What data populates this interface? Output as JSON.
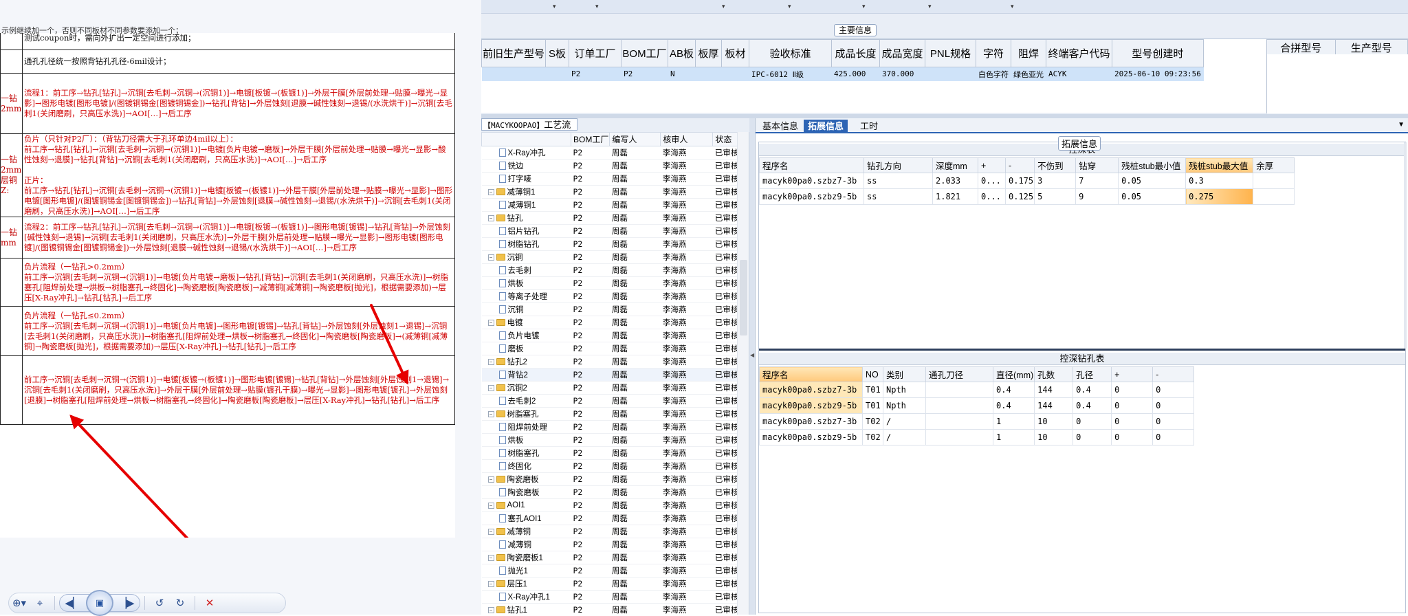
{
  "doc": {
    "top_fragment": "示例继续加一个，否则不同板材不同参数要添加一个；",
    "rows": [
      {
        "label": "",
        "text": "测试coupon时，需向外扩出一定空间进行添加；",
        "style": "blk"
      },
      {
        "label": "",
        "text": "通孔孔径统一按照背钻孔孔径-6mil设计；",
        "style": "blk"
      },
      {
        "label": "一钻\n2mm",
        "text": "流程1：前工序→钻孔[钻孔]→沉铜[去毛刺→沉铜→(沉铜1)]→电镀[板镀→(板镀1)]→外层干膜[外层前处理→贴膜→曝光→显影]→图形电镀[图形电镀]/(图镀铜锡金[图镀铜锡金])→钻孔[背钻]→外层蚀刻[退膜→碱性蚀刻→退锡/(水洗烘干)]→沉铜[去毛刺1(关闭磨刷，只高压水洗)]→AOI[…]→后工序",
        "style": "red"
      },
      {
        "label": "一钻\n2mm\n层铜\nZ:",
        "text": "负片（只针对P2厂）：（背钻刀径需大于孔环单边4mil以上）：\n前工序→钻孔[钻孔]→沉铜[去毛刺→沉铜→(沉铜1)]→电镀[负片电镀→磨板]→外层干膜[外层前处理→贴膜→曝光→显影→酸性蚀刻→退膜]→钻孔[背钻]→沉铜[去毛刺1(关闭磨刷，只高压水洗)]→AOI[…]→后工序\n\n正片：\n前工序→钻孔[钻孔]→沉铜[去毛刺→沉铜→(沉铜1)]→电镀[板镀→(板镀1)]→外层干膜[外层前处理→贴膜→曝光→显影]→图形电镀[图形电镀]/(图镀铜锡金[图镀铜锡金])→钻孔[背钻]→外层蚀刻[退膜→碱性蚀刻→退锡/(水洗烘干)]→沉铜[去毛刺1(关闭磨刷，只高压水洗)]→AOI[…]→后工序",
        "style": "red"
      },
      {
        "label": "一钻\nmm",
        "text": "流程2：前工序→钻孔[钻孔]→沉铜[去毛刺→沉铜→(沉铜1)]→电镀[板镀→(板镀1)]→图形电镀[镀锡]→钻孔[背钻]→外层蚀刻[碱性蚀刻→退锡]→沉铜[去毛刺1(关闭磨刷，只高压水洗)]→外层干膜[外层前处理→贴膜→曝光→显影]→图形电镀[图形电镀]/(图镀铜锡金[图镀铜锡金])→外层蚀刻[退膜→碱性蚀刻→退锡/(水洗烘干)]→AOI[…]→后工序",
        "style": "red"
      },
      {
        "label": "",
        "text": "负片流程（一钻孔>0.2mm）\n前工序→沉铜[去毛刺→沉铜→(沉铜1)]→电镀[负片电镀→磨板]→钻孔[背钻]→沉铜[去毛刺1(关闭磨刷，只高压水洗)]→树脂塞孔[阻焊前处理→烘板→树脂塞孔→终固化]→陶瓷磨板[陶瓷磨板]→减薄铜[减薄铜]→陶瓷磨板[抛光]，根据需要添加)→层压[X-Ray冲孔]→钻孔[钻孔]→后工序",
        "style": "red"
      },
      {
        "label": "",
        "text": "负片流程（一钻孔≤0.2mm）\n前工序→沉铜[去毛刺→沉铜→(沉铜1)]→电镀[负片电镀]→图形电镀[镀锡]→钻孔[背钻]→外层蚀刻[外层蚀刻1→退锡]→沉铜[去毛刺1(关闭磨刷，只高压水洗)]→树脂塞孔[阻焊前处理→烘板→树脂塞孔→终固化]→陶瓷磨板[陶瓷磨板]→(减薄铜[减薄铜]→陶瓷磨板[抛光]，根据需要添加)→层压[X-Ray冲孔]→钻孔[钻孔]→后工序",
        "style": "red"
      },
      {
        "label": "",
        "text": "前工序→沉铜[去毛刺→沉铜→(沉铜1)]→电镀[板镀→(板镀1)]→图形电镀[镀锡]→钻孔[背钻]→外层蚀刻[外层蚀刻1→退锡]→沉铜[去毛刺1(关闭磨刷，只高压水洗)]→外层干膜[外层前处理→贴膜(镀孔干膜)→曝光→显影]→图形电镀[镀孔]→外层蚀刻[退膜]→树脂塞孔[阻焊前处理→烘板→树脂塞孔→终固化]→陶瓷磨板[陶瓷磨板]→层压[X-Ray冲孔]→钻孔[钻孔]→后工序",
        "style": "red"
      }
    ],
    "toolbar_icons": [
      "zoom-icon",
      "fit-page-icon",
      "first-page-icon",
      "prev-page-icon",
      "slideshow-icon",
      "next-page-icon",
      "last-page-icon",
      "rotate-left-icon",
      "rotate-right-icon",
      "delete-icon"
    ]
  },
  "app": {
    "main_info_title": "主要信息",
    "main_columns": [
      "前旧生产型号",
      "S板",
      "订单工厂",
      "BOM工厂",
      "AB板",
      "板厚",
      "板材",
      "验收标准",
      "成品长度",
      "成品宽度",
      "PNL规格",
      "字符",
      "阻焊",
      "终端客户代码",
      "型号创建时"
    ],
    "main_row": [
      "",
      "",
      "P2",
      "P2",
      "N",
      "",
      "",
      "IPC-6012 Ⅱ级",
      "425.000",
      "370.000",
      "",
      "白色字符",
      "绿色亚光",
      "ACYK",
      "2025-06-10 09:23:56"
    ],
    "merge_columns": [
      "合拼型号",
      "生产型号"
    ],
    "process_title_prefix": "【MACYKOOPAO】",
    "process_title": "工艺流程",
    "process_columns": [
      "",
      "BOM工厂",
      "编写人",
      "核审人",
      "状态"
    ],
    "process_rows": [
      {
        "name": "X-Ray冲孔",
        "level": 2,
        "kind": "file",
        "bom": "P2",
        "writer": "周磊",
        "reviewer": "李海燕",
        "status": "已审核"
      },
      {
        "name": "铣边",
        "level": 2,
        "kind": "file",
        "bom": "P2",
        "writer": "周磊",
        "reviewer": "李海燕",
        "status": "已审核"
      },
      {
        "name": "打字唛",
        "level": 2,
        "kind": "file",
        "bom": "P2",
        "writer": "周磊",
        "reviewer": "李海燕",
        "status": "已审核"
      },
      {
        "name": "减薄铜1",
        "level": 1,
        "kind": "folder",
        "bom": "P2",
        "writer": "周磊",
        "reviewer": "李海燕",
        "status": "已审核"
      },
      {
        "name": "减薄铜1",
        "level": 2,
        "kind": "file",
        "bom": "P2",
        "writer": "周磊",
        "reviewer": "李海燕",
        "status": "已审核"
      },
      {
        "name": "钻孔",
        "level": 1,
        "kind": "folder",
        "bom": "P2",
        "writer": "周磊",
        "reviewer": "李海燕",
        "status": "已审核"
      },
      {
        "name": "铝片钻孔",
        "level": 2,
        "kind": "file",
        "bom": "P2",
        "writer": "周磊",
        "reviewer": "李海燕",
        "status": "已审核"
      },
      {
        "name": "树脂钻孔",
        "level": 2,
        "kind": "file",
        "bom": "P2",
        "writer": "周磊",
        "reviewer": "李海燕",
        "status": "已审核"
      },
      {
        "name": "沉铜",
        "level": 1,
        "kind": "folder",
        "bom": "P2",
        "writer": "周磊",
        "reviewer": "李海燕",
        "status": "已审核"
      },
      {
        "name": "去毛刺",
        "level": 2,
        "kind": "file",
        "bom": "P2",
        "writer": "周磊",
        "reviewer": "李海燕",
        "status": "已审核"
      },
      {
        "name": "烘板",
        "level": 2,
        "kind": "file",
        "bom": "P2",
        "writer": "周磊",
        "reviewer": "李海燕",
        "status": "已审核"
      },
      {
        "name": "等离子处理",
        "level": 2,
        "kind": "file",
        "bom": "P2",
        "writer": "周磊",
        "reviewer": "李海燕",
        "status": "已审核"
      },
      {
        "name": "沉铜",
        "level": 2,
        "kind": "file",
        "bom": "P2",
        "writer": "周磊",
        "reviewer": "李海燕",
        "status": "已审核"
      },
      {
        "name": "电镀",
        "level": 1,
        "kind": "folder",
        "bom": "P2",
        "writer": "周磊",
        "reviewer": "李海燕",
        "status": "已审核"
      },
      {
        "name": "负片电镀",
        "level": 2,
        "kind": "file",
        "bom": "P2",
        "writer": "周磊",
        "reviewer": "李海燕",
        "status": "已审核"
      },
      {
        "name": "磨板",
        "level": 2,
        "kind": "file",
        "bom": "P2",
        "writer": "周磊",
        "reviewer": "李海燕",
        "status": "已审核"
      },
      {
        "name": "钻孔2",
        "level": 1,
        "kind": "folder",
        "bom": "P2",
        "writer": "周磊",
        "reviewer": "李海燕",
        "status": "已审核"
      },
      {
        "name": "背钻2",
        "level": 2,
        "kind": "file",
        "bom": "P2",
        "writer": "周磊",
        "reviewer": "李海燕",
        "status": "已审核",
        "selected": true
      },
      {
        "name": "沉铜2",
        "level": 1,
        "kind": "folder",
        "bom": "P2",
        "writer": "周磊",
        "reviewer": "李海燕",
        "status": "已审核"
      },
      {
        "name": "去毛刺2",
        "level": 2,
        "kind": "file",
        "bom": "P2",
        "writer": "周磊",
        "reviewer": "李海燕",
        "status": "已审核"
      },
      {
        "name": "树脂塞孔",
        "level": 1,
        "kind": "folder",
        "bom": "P2",
        "writer": "周磊",
        "reviewer": "李海燕",
        "status": "已审核"
      },
      {
        "name": "阻焊前处理",
        "level": 2,
        "kind": "file",
        "bom": "P2",
        "writer": "周磊",
        "reviewer": "李海燕",
        "status": "已审核"
      },
      {
        "name": "烘板",
        "level": 2,
        "kind": "file",
        "bom": "P2",
        "writer": "周磊",
        "reviewer": "李海燕",
        "status": "已审核"
      },
      {
        "name": "树脂塞孔",
        "level": 2,
        "kind": "file",
        "bom": "P2",
        "writer": "周磊",
        "reviewer": "李海燕",
        "status": "已审核"
      },
      {
        "name": "终固化",
        "level": 2,
        "kind": "file",
        "bom": "P2",
        "writer": "周磊",
        "reviewer": "李海燕",
        "status": "已审核"
      },
      {
        "name": "陶瓷磨板",
        "level": 1,
        "kind": "folder",
        "bom": "P2",
        "writer": "周磊",
        "reviewer": "李海燕",
        "status": "已审核"
      },
      {
        "name": "陶瓷磨板",
        "level": 2,
        "kind": "file",
        "bom": "P2",
        "writer": "周磊",
        "reviewer": "李海燕",
        "status": "已审核"
      },
      {
        "name": "AOI1",
        "level": 1,
        "kind": "folder",
        "bom": "P2",
        "writer": "周磊",
        "reviewer": "李海燕",
        "status": "已审核"
      },
      {
        "name": "塞孔AOI1",
        "level": 2,
        "kind": "file",
        "bom": "P2",
        "writer": "周磊",
        "reviewer": "李海燕",
        "status": "已审核"
      },
      {
        "name": "减薄铜",
        "level": 1,
        "kind": "folder",
        "bom": "P2",
        "writer": "周磊",
        "reviewer": "李海燕",
        "status": "已审核"
      },
      {
        "name": "减薄铜",
        "level": 2,
        "kind": "file",
        "bom": "P2",
        "writer": "周磊",
        "reviewer": "李海燕",
        "status": "已审核"
      },
      {
        "name": "陶瓷磨板1",
        "level": 1,
        "kind": "folder",
        "bom": "P2",
        "writer": "周磊",
        "reviewer": "李海燕",
        "status": "已审核"
      },
      {
        "name": "抛光1",
        "level": 2,
        "kind": "file",
        "bom": "P2",
        "writer": "周磊",
        "reviewer": "李海燕",
        "status": "已审核"
      },
      {
        "name": "层压1",
        "level": 1,
        "kind": "folder",
        "bom": "P2",
        "writer": "周磊",
        "reviewer": "李海燕",
        "status": "已审核"
      },
      {
        "name": "X-Ray冲孔1",
        "level": 2,
        "kind": "file",
        "bom": "P2",
        "writer": "周磊",
        "reviewer": "李海燕",
        "status": "已审核"
      },
      {
        "name": "钻孔1",
        "level": 1,
        "kind": "folder",
        "bom": "P2",
        "writer": "周磊",
        "reviewer": "李海燕",
        "status": "已审核"
      }
    ],
    "tabs": [
      "基本信息",
      "拓展信息",
      "工时"
    ],
    "active_tab": 1,
    "ext_title": "拓展信息",
    "depth_title": "控深表",
    "depth_columns": [
      "程序名",
      "钻孔方向",
      "深度mm",
      "+",
      "-",
      "不伤到",
      "钻穿",
      "残桩stub最小值",
      "残桩stub最大值",
      "余厚"
    ],
    "depth_rows": [
      [
        "macyk00pa0.szbz7-3b",
        "ss",
        "2.033",
        "0...",
        "0.175",
        "3",
        "7",
        "0.05",
        "0.3",
        ""
      ],
      [
        "macyk00pa0.szbz9-5b",
        "ss",
        "1.821",
        "0...",
        "0.125",
        "5",
        "9",
        "0.05",
        "0.275",
        ""
      ]
    ],
    "hole_title": "控深钻孔表",
    "hole_columns": [
      "程序名",
      "NO",
      "类别",
      "通孔刀径",
      "直径(mm)",
      "孔数",
      "孔径",
      "+",
      "-"
    ],
    "hole_rows": [
      [
        "macyk00pa0.szbz7-3b",
        "T01",
        "Npth",
        "",
        "0.4",
        "144",
        "0.4",
        "0",
        "0"
      ],
      [
        "macyk00pa0.szbz9-5b",
        "T01",
        "Npth",
        "",
        "0.4",
        "144",
        "0.4",
        "0",
        "0"
      ],
      [
        "macyk00pa0.szbz7-3b",
        "T02",
        "/",
        "",
        "1",
        "10",
        "0",
        "0",
        "0"
      ],
      [
        "macyk00pa0.szbz9-5b",
        "T02",
        "/",
        "",
        "1",
        "10",
        "0",
        "0",
        "0"
      ]
    ]
  },
  "colors": {
    "accent": "#2d64b4",
    "highlight": "#ffb34c",
    "arrow": "#e60000",
    "doc_text": "#d00000"
  }
}
